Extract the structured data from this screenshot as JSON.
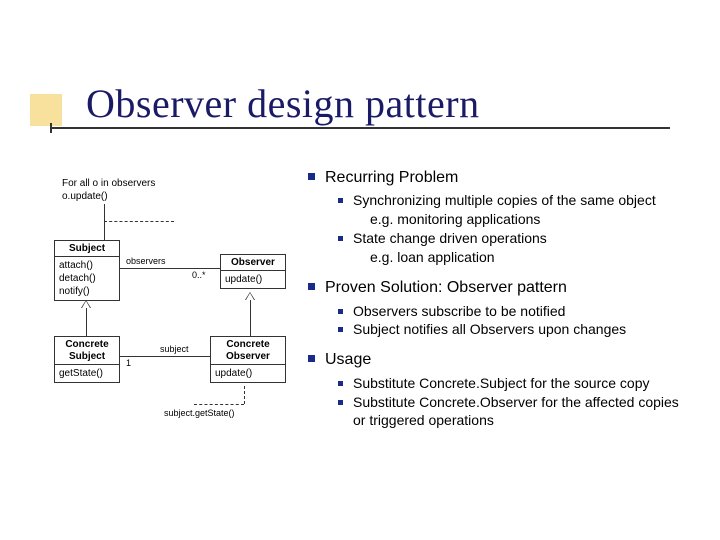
{
  "title": "Observer design pattern",
  "uml": {
    "note_line1": "For all o in observers",
    "note_line2": "o.update()",
    "subject_head": "Subject",
    "subject_m1": "attach()",
    "subject_m2": "detach()",
    "subject_m3": "notify()",
    "observer_head": "Observer",
    "observer_m1": "update()",
    "csubject_head_l1": "Concrete",
    "csubject_head_l2": "Subject",
    "csubject_m1": "getState()",
    "cobserver_head_l1": "Concrete",
    "cobserver_head_l2": "Observer",
    "cobserver_m1": "update()",
    "label_observers": "observers",
    "label_mult_1_star": "1",
    "label_mult_star": "0..*",
    "label_subject_role": "subject",
    "caption_getstate": "subject.getState()"
  },
  "bullets": {
    "s1": "Recurring Problem",
    "s1a": "Synchronizing multiple copies of the same object",
    "s1a_e": "e.g. monitoring applications",
    "s1b": "State change driven operations",
    "s1b_e": "e.g. loan application",
    "s2": "Proven Solution: Observer pattern",
    "s2a": "Observers subscribe to be notified",
    "s2b": "Subject notifies all Observers upon changes",
    "s3": "Usage",
    "s3a": "Substitute Concrete.Subject for the source copy",
    "s3b": "Substitute Concrete.Observer for the affected copies or triggered operations"
  }
}
